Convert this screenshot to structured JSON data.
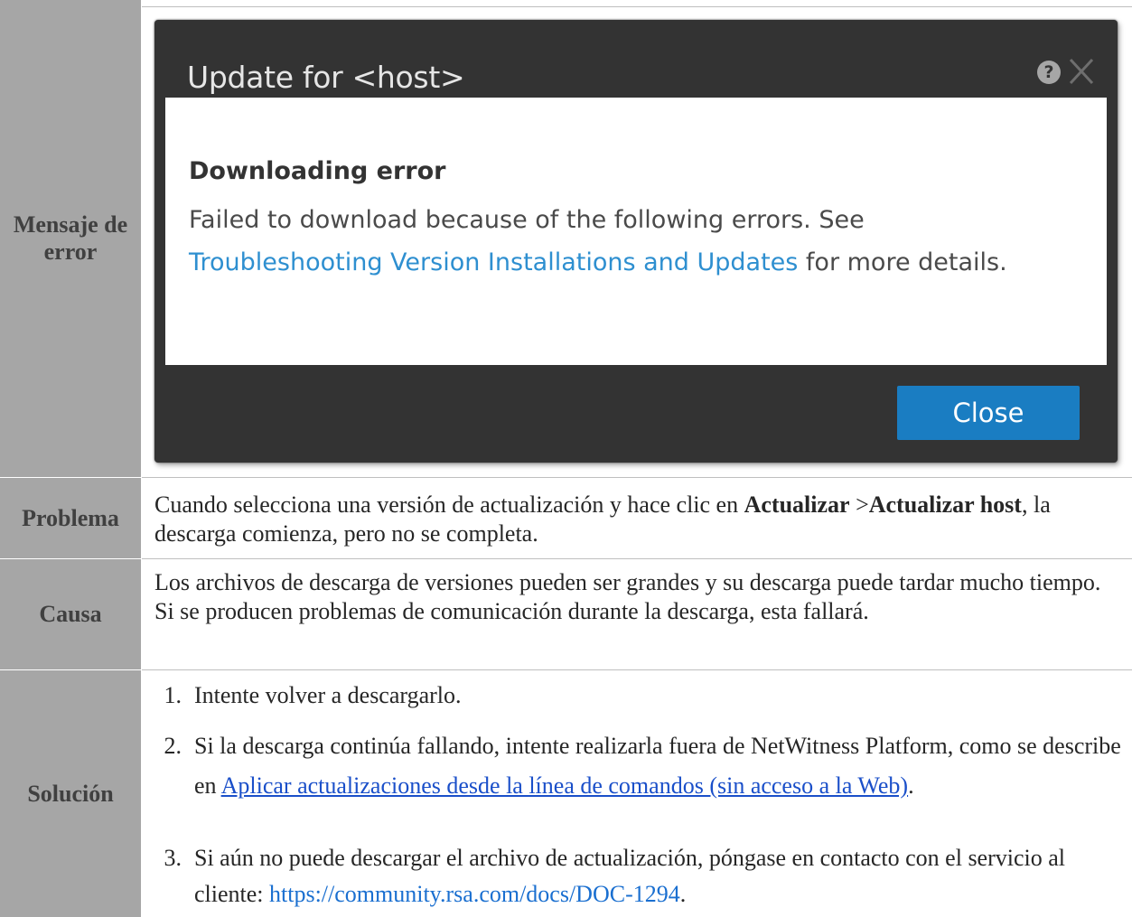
{
  "rows": {
    "error": {
      "header": "Mensaje de error"
    },
    "problem": {
      "header": "Problema",
      "text_1": "Cuando selecciona una versión de actualización y hace clic en ",
      "bold_1": "Actualizar",
      "text_2": " >",
      "bold_2": "Actualizar host",
      "text_3": ", la descarga comienza, pero no se completa."
    },
    "cause": {
      "header": "Causa",
      "text": "Los archivos de descarga de versiones pueden ser grandes y su descarga puede tardar mucho tiempo. Si se producen problemas de comunicación durante la descarga, esta fallará."
    },
    "solution": {
      "header": "Solución",
      "items": [
        {
          "num": "1.",
          "text": "Intente volver a descargarlo."
        },
        {
          "num": "2.",
          "text": "Si la descarga continúa fallando, intente realizarla fuera de NetWitness Platform, como se describe en ",
          "link": "Aplicar actualizaciones desde la línea de comandos (sin acceso a la Web)",
          "after": "."
        },
        {
          "num": "3.",
          "text": "Si aún no puede descargar el archivo de actualización, póngase en contacto con el servicio al cliente: ",
          "link": "https://community.rsa.com/docs/DOC-1294",
          "after": "."
        }
      ]
    }
  },
  "dialog": {
    "title": "Update for <host>",
    "help_icon": "question-circle-icon",
    "close_icon": "x-icon",
    "error_title": "Downloading error",
    "error_text_before": "Failed to download because of the following errors. See ",
    "error_link": "Troubleshooting Version Installations and Updates",
    "error_text_after": " for more details.",
    "button_label": "Close",
    "colors": {
      "frame": "#333333",
      "button": "#1a7dc2",
      "link": "#2e8fd0"
    }
  },
  "colors": {
    "header_bg": "#a6a6a6",
    "doc_link": "#1a4fc9"
  }
}
